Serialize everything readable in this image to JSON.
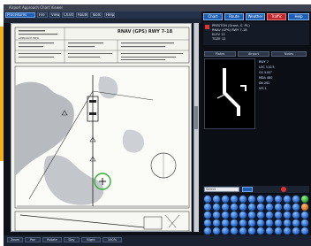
{
  "window": {
    "title": "Airport Approach Chart Viewer",
    "menu": [
      "File",
      "View",
      "Charts",
      "Route",
      "Tools",
      "Help"
    ],
    "brand_button": "Procedures"
  },
  "chart": {
    "procedure_title": "RNAV (GPS) RWY 7-18",
    "header_small": "APPROACH INFO"
  },
  "right_panel": {
    "buttons": [
      "Chart",
      "Route",
      "Weather",
      "Traffic",
      "Help"
    ],
    "info_lines": [
      "PRESTON (Grant, S. Pt.)",
      "RNAV (GPS) RWY 7-18",
      "ELEV 12",
      "TDZE 12"
    ],
    "tabs": [
      "Plates",
      "Airport",
      "Notes"
    ],
    "data_lines": [
      "RWY 7",
      "LOC 110.5",
      "GS 3.00°",
      "MDA 480",
      "DA 262",
      "VIS 1"
    ],
    "search_label": "Select"
  },
  "status": [
    "Zoom",
    "Pan",
    "Rotate",
    "Day",
    "Night",
    "100%"
  ],
  "colors": {
    "accent": "#1e5fb4",
    "alert": "#c0262b",
    "background": "#0e1117"
  }
}
